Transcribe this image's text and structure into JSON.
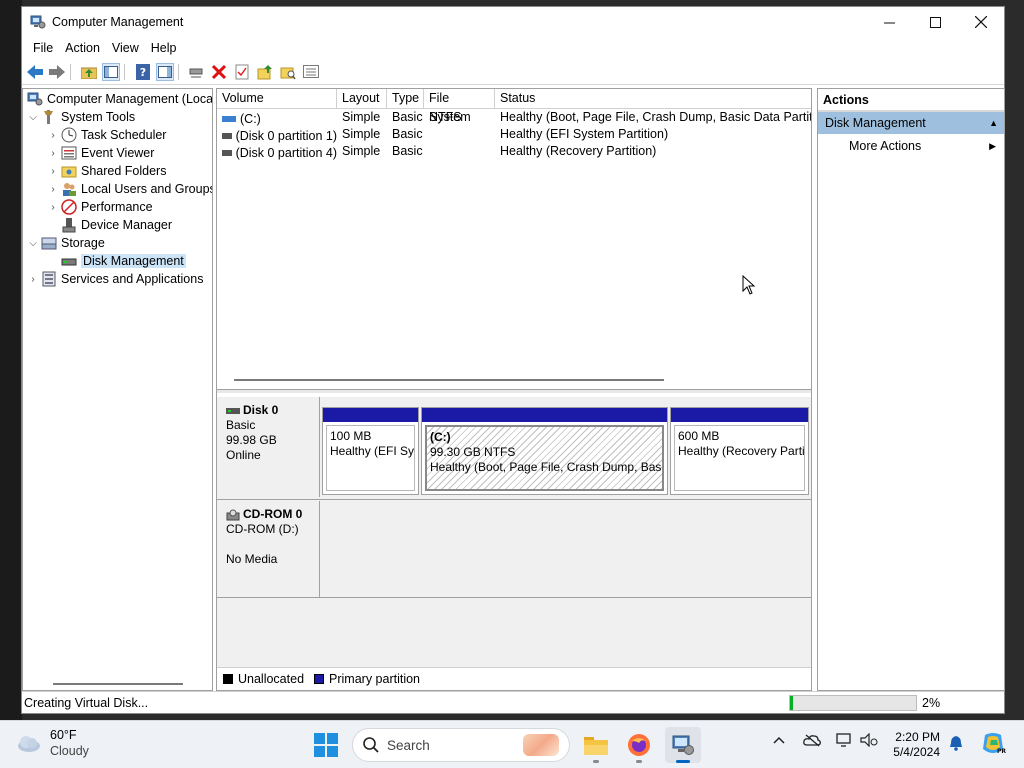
{
  "window": {
    "title": "Computer Management"
  },
  "menu": [
    "File",
    "Action",
    "View",
    "Help"
  ],
  "tree": {
    "root": "Computer Management (Local",
    "system_tools": "System Tools",
    "task_scheduler": "Task Scheduler",
    "event_viewer": "Event Viewer",
    "shared_folders": "Shared Folders",
    "local_users": "Local Users and Groups",
    "performance": "Performance",
    "device_manager": "Device Manager",
    "storage": "Storage",
    "disk_management": "Disk Management",
    "services": "Services and Applications"
  },
  "volumes": {
    "columns": [
      "Volume",
      "Layout",
      "Type",
      "File System",
      "Status"
    ],
    "rows": [
      {
        "volume": "(C:)",
        "layout": "Simple",
        "type": "Basic",
        "fs": "NTFS",
        "status": "Healthy (Boot, Page File, Crash Dump, Basic Data Partition)"
      },
      {
        "volume": "(Disk 0 partition 1)",
        "layout": "Simple",
        "type": "Basic",
        "fs": "",
        "status": "Healthy (EFI System Partition)"
      },
      {
        "volume": "(Disk 0 partition 4)",
        "layout": "Simple",
        "type": "Basic",
        "fs": "",
        "status": "Healthy (Recovery Partition)"
      }
    ]
  },
  "disks": {
    "disk0": {
      "name": "Disk 0",
      "type": "Basic",
      "size": "99.98 GB",
      "state": "Online",
      "partitions": [
        {
          "line1": "",
          "line2": "100 MB",
          "line3": "Healthy (EFI Sys"
        },
        {
          "line1": "(C:)",
          "line2": "99.30 GB NTFS",
          "line3": "Healthy (Boot, Page File, Crash Dump, Basic"
        },
        {
          "line1": "",
          "line2": "600 MB",
          "line3": "Healthy (Recovery Parti"
        }
      ]
    },
    "cdrom0": {
      "name": "CD-ROM 0",
      "drive": "CD-ROM (D:)",
      "media": "No Media"
    }
  },
  "legend": {
    "unallocated": "Unallocated",
    "primary": "Primary partition"
  },
  "actions": {
    "title": "Actions",
    "section": "Disk Management",
    "more": "More Actions"
  },
  "status": {
    "text": "Creating Virtual Disk...",
    "percent_label": "2%",
    "progress": 0.02
  },
  "taskbar": {
    "weather_temp": "60°F",
    "weather_cond": "Cloudy",
    "search_placeholder": "Search",
    "time": "2:20 PM",
    "date": "5/4/2024"
  },
  "colors": {
    "primary_partition": "#1a1aa6",
    "unallocated": "#000000",
    "actions_header": "#9ec0de",
    "progress": "#06b025"
  }
}
